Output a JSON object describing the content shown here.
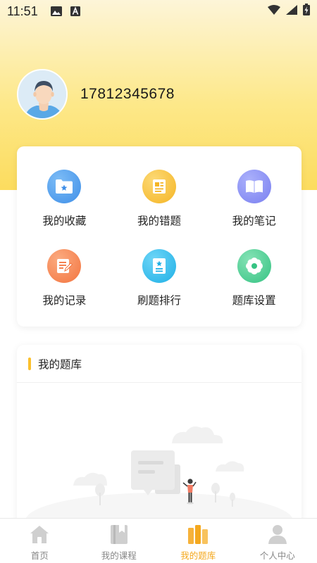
{
  "status_bar": {
    "time": "11:51"
  },
  "profile": {
    "phone": "17812345678"
  },
  "menu": [
    {
      "label": "我的收藏",
      "icon": "folder-star-icon",
      "color": "#4a9ef0"
    },
    {
      "label": "我的错题",
      "icon": "wrong-questions-icon",
      "color": "#f9c43a"
    },
    {
      "label": "我的笔记",
      "icon": "book-icon",
      "color": "#8d93f5"
    },
    {
      "label": "我的记录",
      "icon": "record-edit-icon",
      "color": "#f78b57"
    },
    {
      "label": "刷题排行",
      "icon": "ranking-star-icon",
      "color": "#36c0ee"
    },
    {
      "label": "题库设置",
      "icon": "gear-icon",
      "color": "#4ccf92"
    }
  ],
  "question_bank": {
    "title": "我的题库"
  },
  "tabbar": {
    "items": [
      {
        "label": "首页",
        "icon": "home-icon"
      },
      {
        "label": "我的课程",
        "icon": "course-book-icon"
      },
      {
        "label": "我的题库",
        "icon": "question-bank-icon",
        "active": true
      },
      {
        "label": "个人中心",
        "icon": "person-icon"
      }
    ],
    "active_color": "#f4a81e"
  },
  "colors": {
    "accent": "#fbc02d",
    "header_gradient_end": "#fcdc5e"
  }
}
